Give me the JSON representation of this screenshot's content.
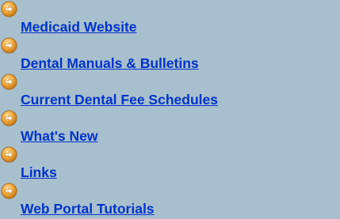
{
  "nav": {
    "items": [
      {
        "label": "Medicaid Website"
      },
      {
        "label": "Dental Manuals & Bulletins"
      },
      {
        "label": "Current Dental Fee Schedules"
      },
      {
        "label": "What's New"
      },
      {
        "label": "Links"
      },
      {
        "label": "Web Portal Tutorials"
      }
    ]
  },
  "colors": {
    "background": "#a8bfcd",
    "link": "#0033cc",
    "bullet": "#e8a13a"
  },
  "icons": {
    "bullet": "circle-arrow-right-icon"
  }
}
